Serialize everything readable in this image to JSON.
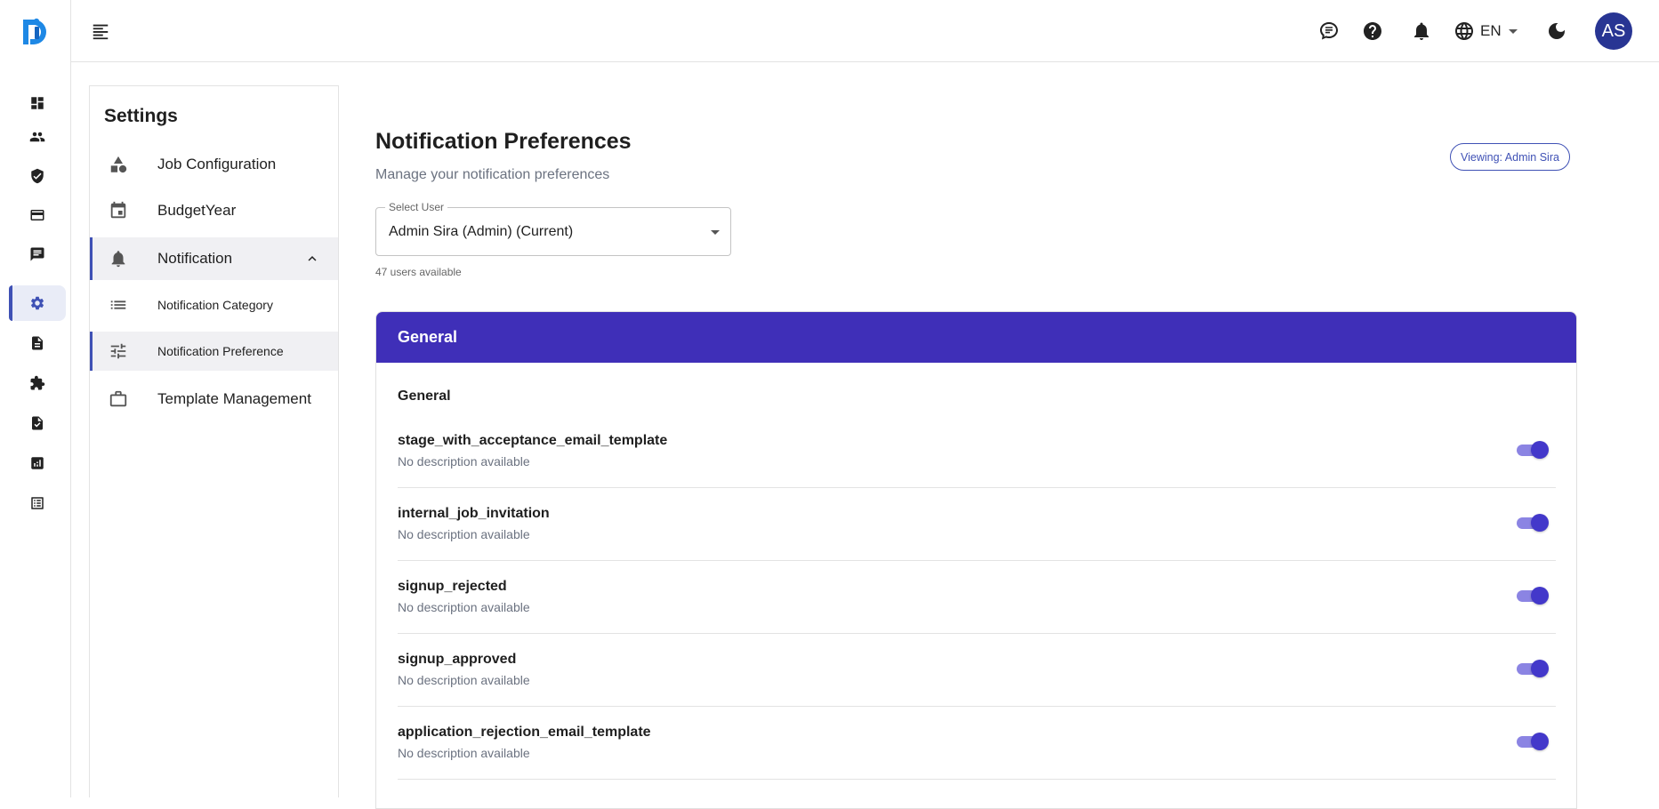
{
  "topbar": {
    "language": "EN",
    "avatar_initials": "AS"
  },
  "rail": {
    "items": [
      "dashboard-icon",
      "people-icon",
      "shield-icon",
      "credit-card-icon",
      "chat-icon",
      "settings-icon",
      "document-icon",
      "puzzle-icon",
      "file-check-icon",
      "analytics-icon",
      "list-alt-icon"
    ],
    "active": "settings-icon"
  },
  "settings_nav": {
    "title": "Settings",
    "items": [
      {
        "label": "Job Configuration"
      },
      {
        "label": "BudgetYear"
      },
      {
        "label": "Notification"
      },
      {
        "label": "Notification Category"
      },
      {
        "label": "Notification Preference"
      },
      {
        "label": "Template Management"
      }
    ]
  },
  "main": {
    "title": "Notification Preferences",
    "subtitle": "Manage your notification preferences",
    "viewing_badge": "Viewing: Admin Sira",
    "select_user": {
      "label": "Select User",
      "value": "Admin Sira (Admin) (Current)",
      "users_count": "47 users available"
    },
    "card": {
      "header": "General",
      "section": "General",
      "preferences": [
        {
          "name": "stage_with_acceptance_email_template",
          "description": "No description available",
          "enabled": true
        },
        {
          "name": "internal_job_invitation",
          "description": "No description available",
          "enabled": true
        },
        {
          "name": "signup_rejected",
          "description": "No description available",
          "enabled": true
        },
        {
          "name": "signup_approved",
          "description": "No description available",
          "enabled": true
        },
        {
          "name": "application_rejection_email_template",
          "description": "No description available",
          "enabled": true
        }
      ]
    }
  },
  "colors": {
    "accent": "#3f51b5",
    "card_header": "#3f2fb8",
    "avatar_bg": "#283593",
    "toggle_on": "#4338ca"
  }
}
